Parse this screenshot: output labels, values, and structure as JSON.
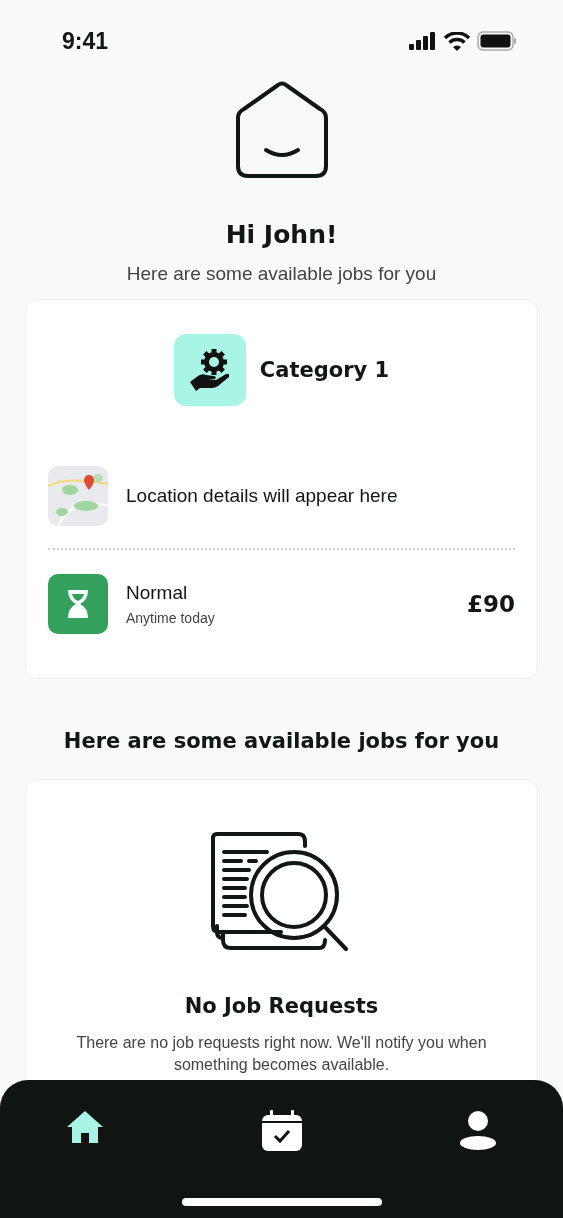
{
  "status_bar": {
    "time": "9:41"
  },
  "greeting": {
    "title": "Hi John!",
    "subtitle": "Here are some available jobs for you"
  },
  "job_card": {
    "category": "Category 1",
    "location": "Location details will appear here",
    "urgency": "Normal",
    "timing": "Anytime today",
    "price": "£90"
  },
  "section_title": "Here are some available jobs for you",
  "empty_state": {
    "title": "No Job Requests",
    "message": "There are no job requests right now. We'll notify you when something becomes available."
  },
  "tab_bar": [
    {
      "kind": "home",
      "selected": true
    },
    {
      "kind": "calendar",
      "selected": false
    },
    {
      "kind": "profile",
      "selected": false
    }
  ]
}
